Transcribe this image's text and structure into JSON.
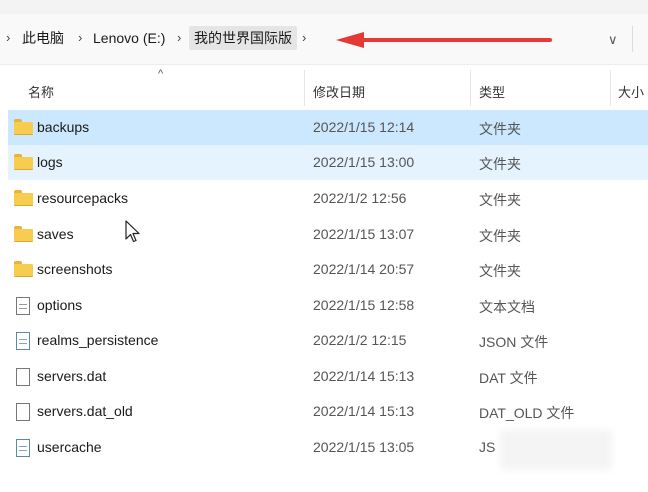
{
  "address": {
    "crumbs": [
      "此电脑",
      "Lenovo (E:)",
      "我的世界国际版"
    ]
  },
  "columns": {
    "name": "名称",
    "date": "修改日期",
    "type": "类型",
    "size": "大小"
  },
  "files": [
    {
      "name": "backups",
      "date": "2022/1/15 12:14",
      "type": "文件夹",
      "icon": "folder-icon"
    },
    {
      "name": "logs",
      "date": "2022/1/15 13:00",
      "type": "文件夹",
      "icon": "folder-icon"
    },
    {
      "name": "resourcepacks",
      "date": "2022/1/2 12:56",
      "type": "文件夹",
      "icon": "folder-icon"
    },
    {
      "name": "saves",
      "date": "2022/1/15 13:07",
      "type": "文件夹",
      "icon": "folder-icon"
    },
    {
      "name": "screenshots",
      "date": "2022/1/14 20:57",
      "type": "文件夹",
      "icon": "folder-icon"
    },
    {
      "name": "options",
      "date": "2022/1/15 12:58",
      "type": "文本文档",
      "icon": "text-document-icon"
    },
    {
      "name": "realms_persistence",
      "date": "2022/1/2 12:15",
      "type": "JSON 文件",
      "icon": "json-file-icon"
    },
    {
      "name": "servers.dat",
      "date": "2022/1/14 15:13",
      "type": "DAT 文件",
      "icon": "file-icon"
    },
    {
      "name": "servers.dat_old",
      "date": "2022/1/14 15:13",
      "type": "DAT_OLD 文件",
      "icon": "file-icon"
    },
    {
      "name": "usercache",
      "date": "2022/1/15 13:05",
      "type": "JS",
      "icon": "json-file-icon"
    }
  ],
  "annotation": {
    "arrow_color": "#e53935"
  }
}
